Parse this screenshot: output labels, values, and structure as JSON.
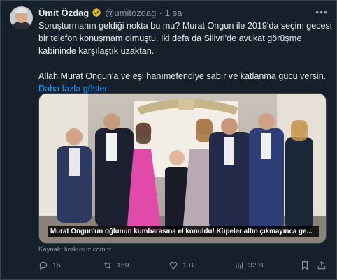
{
  "tweet": {
    "author_name": "Ümit Özdağ",
    "handle": "@umitozdag",
    "separator": "·",
    "time": "1 sa",
    "text_lines": [
      "Soruşturmanın geldiği nokta bu mu? Murat Ongun ile 2019'da seçim gecesi",
      "bir telefon konuşmam olmuştu. İki defa da Silivri'de avukat görüşme",
      "kabininde karşılaştık uzaktan."
    ],
    "text_line_2": "Allah Murat Ongun'a ve eşi hanımefendiye sabır ve katlanma gücü versin.",
    "show_more": "Daha fazla göster",
    "media_caption": "Murat Ongun'un oğlunun kumbarasına el konuldu! Küpeler altın çıkmayınca ge...",
    "source": "Kaynak: korkusuz.com.tr",
    "replies": "15",
    "reposts": "159",
    "likes": "1 B",
    "views": "32 B"
  },
  "colors": {
    "background": "#15202b",
    "verified": "#e2b719",
    "link": "#1d9bf0",
    "muted": "#8b98a5"
  },
  "icons": [
    "verified-badge-icon",
    "more-icon",
    "reply-icon",
    "repost-icon",
    "like-icon",
    "views-icon",
    "bookmark-icon",
    "share-icon"
  ]
}
